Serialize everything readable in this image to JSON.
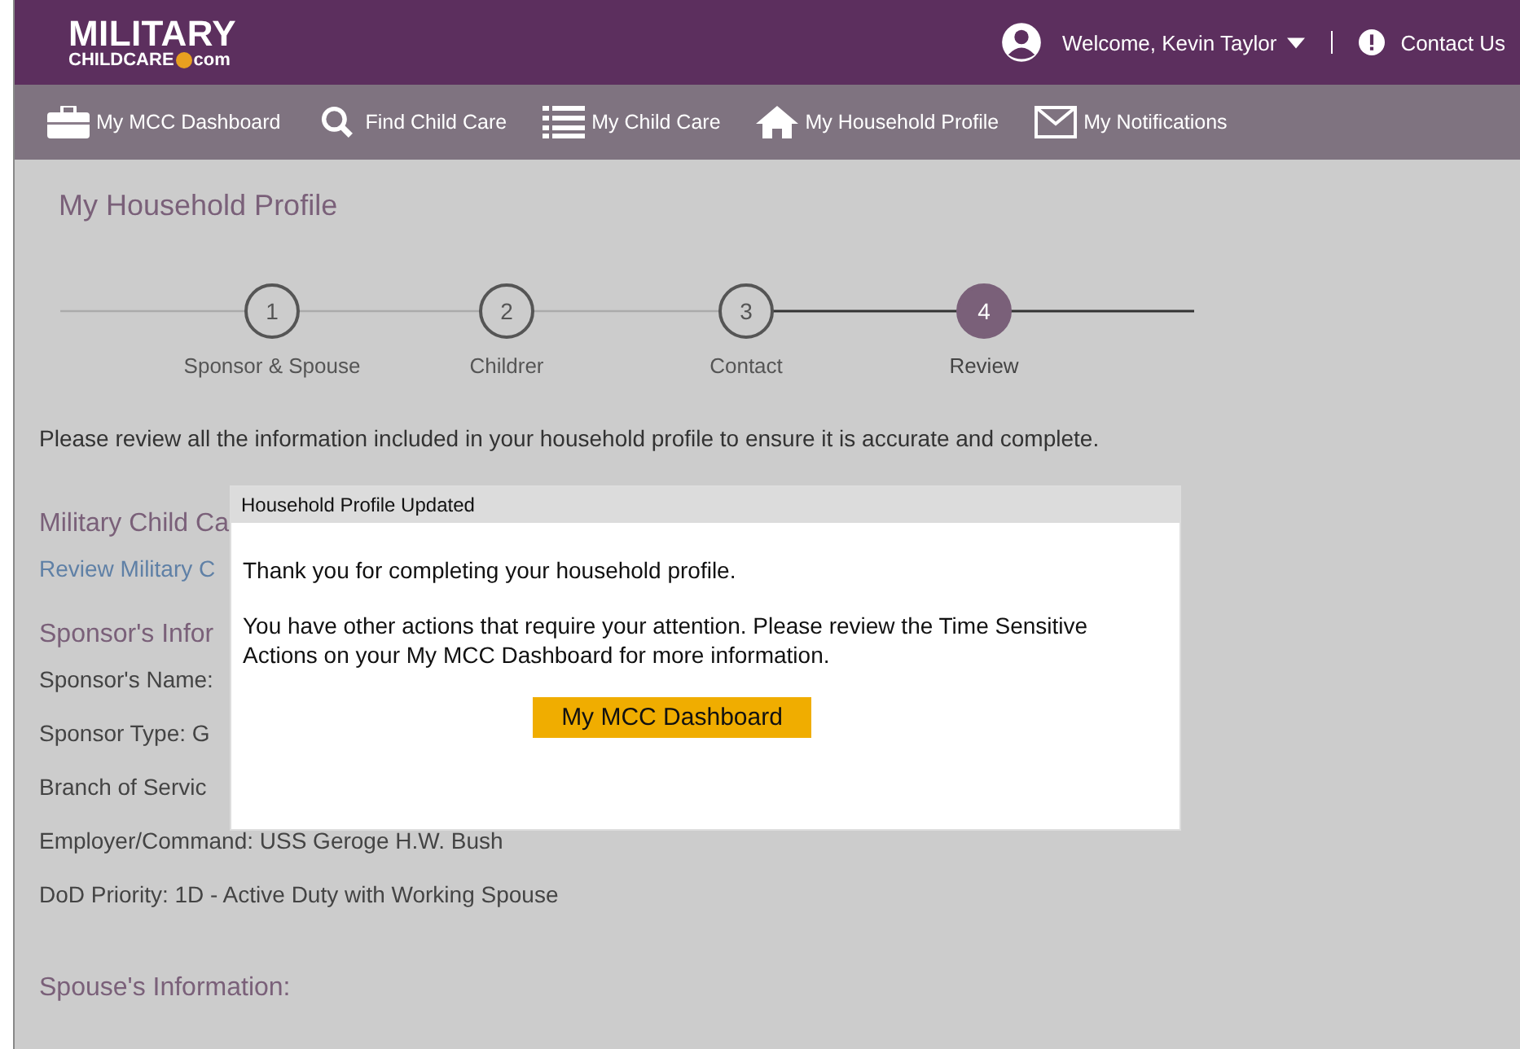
{
  "header": {
    "logo": {
      "line1": "MILITARY",
      "line2": "CHILDCARE",
      "suffix": "com"
    },
    "welcome": "Welcome, Kevin Taylor",
    "contact": "Contact Us"
  },
  "nav": [
    {
      "label": "My MCC Dashboard"
    },
    {
      "label": "Find Child Care"
    },
    {
      "label": "My Child Care"
    },
    {
      "label": "My Household Profile"
    },
    {
      "label": "My Notifications"
    }
  ],
  "page_title": "My Household Profile",
  "steps": [
    {
      "number": "1",
      "label": "Sponsor & Spouse",
      "selected": false
    },
    {
      "number": "2",
      "label": "Childrer",
      "selected": false
    },
    {
      "number": "3",
      "label": "Contact",
      "selected": false
    },
    {
      "number": "4",
      "label": "Review",
      "selected": true
    }
  ],
  "intro": "Please review all the information included in your household profile to ensure it is accurate and complete.",
  "sections": [
    {
      "kind": "heading",
      "text": "Military Child Ca"
    },
    {
      "kind": "link",
      "text": "Review Military C"
    },
    {
      "kind": "heading",
      "text": "Sponsor's Infor"
    },
    {
      "kind": "field",
      "text": "Sponsor's Name:"
    },
    {
      "kind": "field",
      "text": "Sponsor Type: G"
    },
    {
      "kind": "field",
      "text": "Branch of Servic"
    },
    {
      "kind": "field",
      "text": "Employer/Command: USS Geroge H.W. Bush"
    },
    {
      "kind": "field",
      "text": "DoD Priority:  1D -  Active Duty with Working Spouse"
    },
    {
      "kind": "heading",
      "text": "Spouse's Information:"
    }
  ],
  "dialog": {
    "title": "Household Profile Updated",
    "paragraphs": [
      "Thank you for completing your household profile.",
      "You have other actions that require your attention. Please review the Time Sensitive Actions on your My MCC Dashboard for more information."
    ],
    "button": "My MCC Dashboard"
  }
}
